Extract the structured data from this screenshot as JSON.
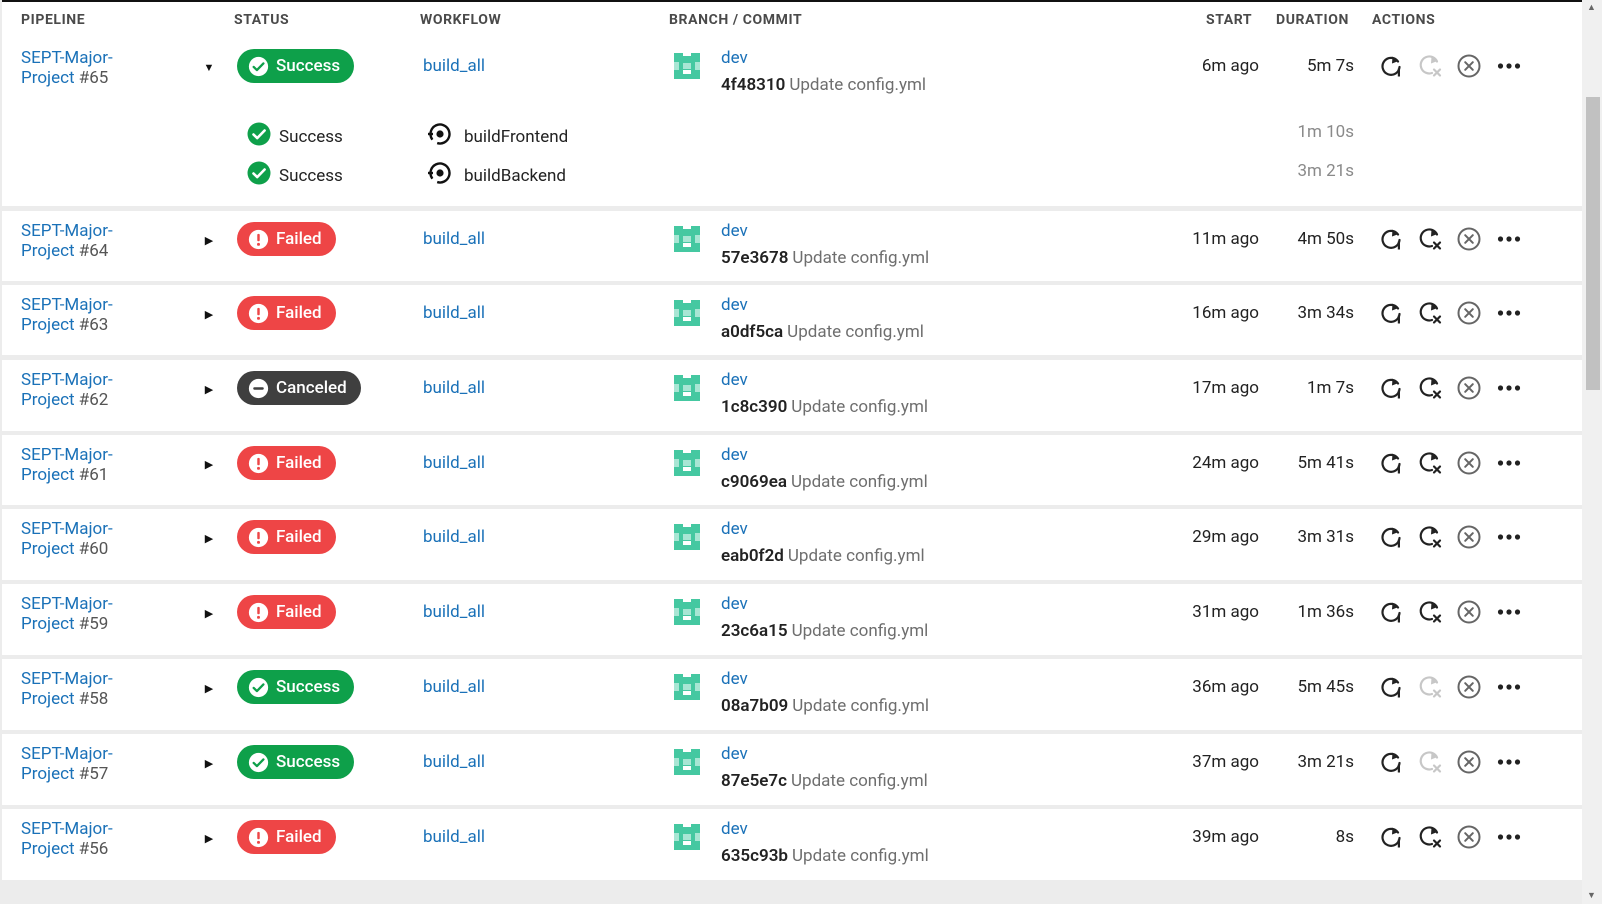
{
  "columns": {
    "pipeline": "PIPELINE",
    "status": "STATUS",
    "workflow": "WORKFLOW",
    "branch_commit": "BRANCH / COMMIT",
    "start": "START",
    "duration": "DURATION",
    "actions": "ACTIONS"
  },
  "colors": {
    "success": "#0ea04a",
    "failed": "#ee4546",
    "canceled": "#3f3f3f",
    "link": "#1a71b8"
  },
  "pipelines": [
    {
      "name1": "SEPT-Major-",
      "name2": "Project",
      "number": "#65",
      "expanded": true,
      "status": "success",
      "status_label": "Success",
      "workflow": "build_all",
      "branch": "dev",
      "sha": "4f48310",
      "message": "Update config.yml",
      "start": "6m ago",
      "duration": "5m 7s",
      "cancel_enabled": false,
      "jobs": [
        {
          "status_label": "Success",
          "name": "buildFrontend",
          "duration": "1m 10s"
        },
        {
          "status_label": "Success",
          "name": "buildBackend",
          "duration": "3m 21s"
        }
      ]
    },
    {
      "name1": "SEPT-Major-",
      "name2": "Project",
      "number": "#64",
      "expanded": false,
      "status": "failed",
      "status_label": "Failed",
      "workflow": "build_all",
      "branch": "dev",
      "sha": "57e3678",
      "message": "Update config.yml",
      "start": "11m ago",
      "duration": "4m 50s",
      "cancel_enabled": true
    },
    {
      "name1": "SEPT-Major-",
      "name2": "Project",
      "number": "#63",
      "expanded": false,
      "status": "failed",
      "status_label": "Failed",
      "workflow": "build_all",
      "branch": "dev",
      "sha": "a0df5ca",
      "message": "Update config.yml",
      "start": "16m ago",
      "duration": "3m 34s",
      "cancel_enabled": true
    },
    {
      "name1": "SEPT-Major-",
      "name2": "Project",
      "number": "#62",
      "expanded": false,
      "status": "canceled",
      "status_label": "Canceled",
      "workflow": "build_all",
      "branch": "dev",
      "sha": "1c8c390",
      "message": "Update config.yml",
      "start": "17m ago",
      "duration": "1m 7s",
      "cancel_enabled": true
    },
    {
      "name1": "SEPT-Major-",
      "name2": "Project",
      "number": "#61",
      "expanded": false,
      "status": "failed",
      "status_label": "Failed",
      "workflow": "build_all",
      "branch": "dev",
      "sha": "c9069ea",
      "message": "Update config.yml",
      "start": "24m ago",
      "duration": "5m 41s",
      "cancel_enabled": true
    },
    {
      "name1": "SEPT-Major-",
      "name2": "Project",
      "number": "#60",
      "expanded": false,
      "status": "failed",
      "status_label": "Failed",
      "workflow": "build_all",
      "branch": "dev",
      "sha": "eab0f2d",
      "message": "Update config.yml",
      "start": "29m ago",
      "duration": "3m 31s",
      "cancel_enabled": true
    },
    {
      "name1": "SEPT-Major-",
      "name2": "Project",
      "number": "#59",
      "expanded": false,
      "status": "failed",
      "status_label": "Failed",
      "workflow": "build_all",
      "branch": "dev",
      "sha": "23c6a15",
      "message": "Update config.yml",
      "start": "31m ago",
      "duration": "1m 36s",
      "cancel_enabled": true
    },
    {
      "name1": "SEPT-Major-",
      "name2": "Project",
      "number": "#58",
      "expanded": false,
      "status": "success",
      "status_label": "Success",
      "workflow": "build_all",
      "branch": "dev",
      "sha": "08a7b09",
      "message": "Update config.yml",
      "start": "36m ago",
      "duration": "5m 45s",
      "cancel_enabled": false
    },
    {
      "name1": "SEPT-Major-",
      "name2": "Project",
      "number": "#57",
      "expanded": false,
      "status": "success",
      "status_label": "Success",
      "workflow": "build_all",
      "branch": "dev",
      "sha": "87e5e7c",
      "message": "Update config.yml",
      "start": "37m ago",
      "duration": "3m 21s",
      "cancel_enabled": false
    },
    {
      "name1": "SEPT-Major-",
      "name2": "Project",
      "number": "#56",
      "expanded": false,
      "status": "failed",
      "status_label": "Failed",
      "workflow": "build_all",
      "branch": "dev",
      "sha": "635c93b",
      "message": "Update config.yml",
      "start": "39m ago",
      "duration": "8s",
      "cancel_enabled": true
    }
  ]
}
